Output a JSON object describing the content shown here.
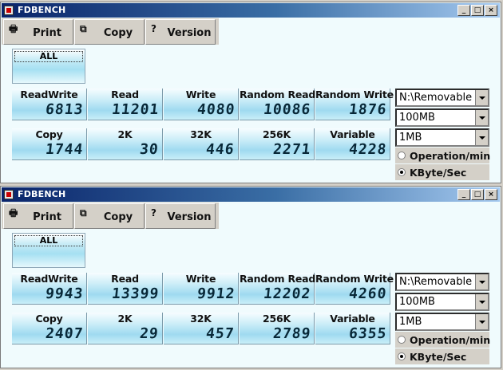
{
  "windows": [
    {
      "title": "FDBENCH",
      "toolbar": {
        "print": "Print",
        "copy": "Copy",
        "version": "Version"
      },
      "all_label": "ALL",
      "row1": [
        {
          "label": "ReadWrite",
          "value": "6813"
        },
        {
          "label": "Read",
          "value": "11201"
        },
        {
          "label": "Write",
          "value": "4080"
        },
        {
          "label": "Random Read",
          "value": "10086"
        },
        {
          "label": "Random Write",
          "value": "1876"
        }
      ],
      "row2": [
        {
          "label": "Copy",
          "value": "1744"
        },
        {
          "label": "2K",
          "value": "30"
        },
        {
          "label": "32K",
          "value": "446"
        },
        {
          "label": "256K",
          "value": "2271"
        },
        {
          "label": "Variable",
          "value": "4228"
        }
      ],
      "drive": "N:\\Removable",
      "file_size": "100MB",
      "block_size": "1MB",
      "radio_operation": "Operation/min",
      "radio_kbyte": "KByte/Sec",
      "selected_unit": "KByte/Sec"
    },
    {
      "title": "FDBENCH",
      "toolbar": {
        "print": "Print",
        "copy": "Copy",
        "version": "Version"
      },
      "all_label": "ALL",
      "row1": [
        {
          "label": "ReadWrite",
          "value": "9943"
        },
        {
          "label": "Read",
          "value": "13399"
        },
        {
          "label": "Write",
          "value": "9912"
        },
        {
          "label": "Random Read",
          "value": "12202"
        },
        {
          "label": "Random Write",
          "value": "4260"
        }
      ],
      "row2": [
        {
          "label": "Copy",
          "value": "2407"
        },
        {
          "label": "2K",
          "value": "29"
        },
        {
          "label": "32K",
          "value": "457"
        },
        {
          "label": "256K",
          "value": "2789"
        },
        {
          "label": "Variable",
          "value": "6355"
        }
      ],
      "drive": "N:\\Removable",
      "file_size": "100MB",
      "block_size": "1MB",
      "radio_operation": "Operation/min",
      "radio_kbyte": "KByte/Sec",
      "selected_unit": "KByte/Sec"
    }
  ]
}
